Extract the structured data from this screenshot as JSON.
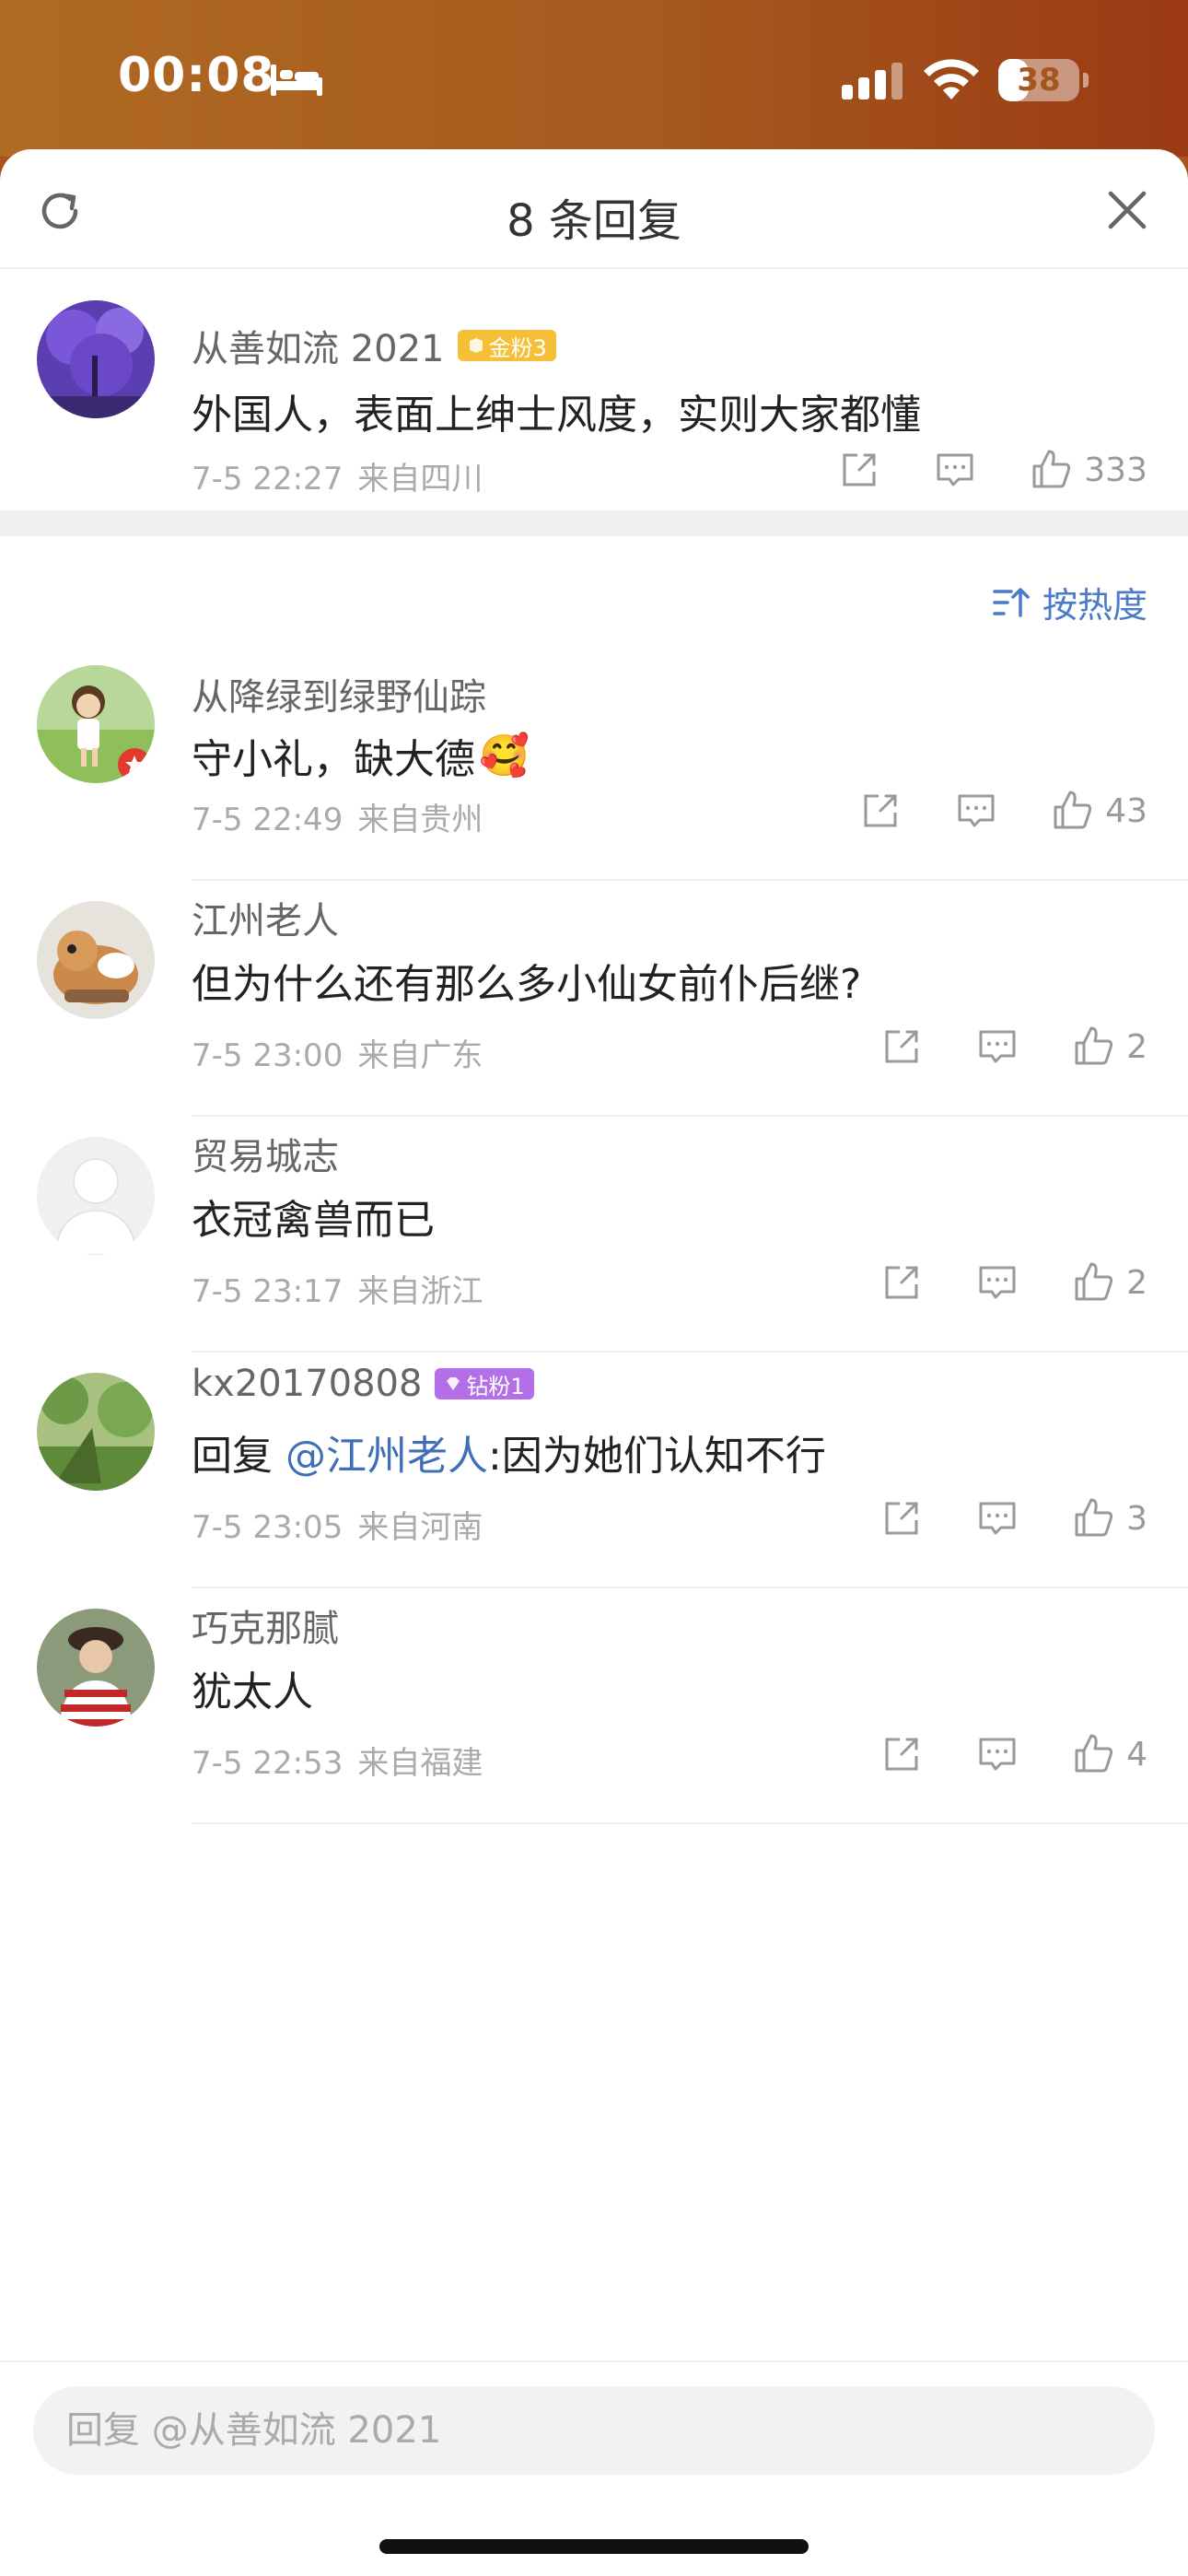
{
  "status": {
    "time": "00:08",
    "battery": "38",
    "battery_level": 0.38
  },
  "header": {
    "title": "8 条回复"
  },
  "root_comment": {
    "username": "从善如流 2021",
    "badge": "金粉3",
    "text": "外国人，表面上绅士风度，实则大家都懂",
    "date": "7-5 22:27",
    "location": "来自四川",
    "likes": "333"
  },
  "sort_label": "按热度",
  "replies": [
    {
      "username": "从降绿到绿野仙踪",
      "text": "守小礼，缺大德",
      "emoji": "🥰",
      "date": "7-5 22:49",
      "location": "来自贵州",
      "likes": "43"
    },
    {
      "username": "江州老人",
      "text": "但为什么还有那么多小仙女前仆后继?",
      "date": "7-5 23:00",
      "location": "来自广东",
      "likes": "2"
    },
    {
      "username": "贸易城志",
      "text": "衣冠禽兽而已",
      "date": "7-5 23:17",
      "location": "来自浙江",
      "likes": "2"
    },
    {
      "username": "kx20170808",
      "badge": "钻粉1",
      "reply_prefix": "回复 ",
      "mention": "@江州老人",
      "text": ":因为她们认知不行",
      "date": "7-5 23:05",
      "location": "来自河南",
      "likes": "3"
    },
    {
      "username": "巧克那腻",
      "text": "犹太人",
      "date": "7-5 22:53",
      "location": "来自福建",
      "likes": "4"
    }
  ],
  "reply_input": {
    "placeholder": "回复 @从善如流 2021"
  },
  "colors": {
    "accent": "#4a7ac8",
    "mention": "#3f6fb6",
    "gold_badge": "#f5c038",
    "diamond_badge": "#b46ee8"
  },
  "icons": [
    "bed-icon",
    "signal-icon",
    "wifi-icon",
    "refresh-icon",
    "close-icon",
    "share-icon",
    "comment-icon",
    "like-icon",
    "sort-icon"
  ]
}
